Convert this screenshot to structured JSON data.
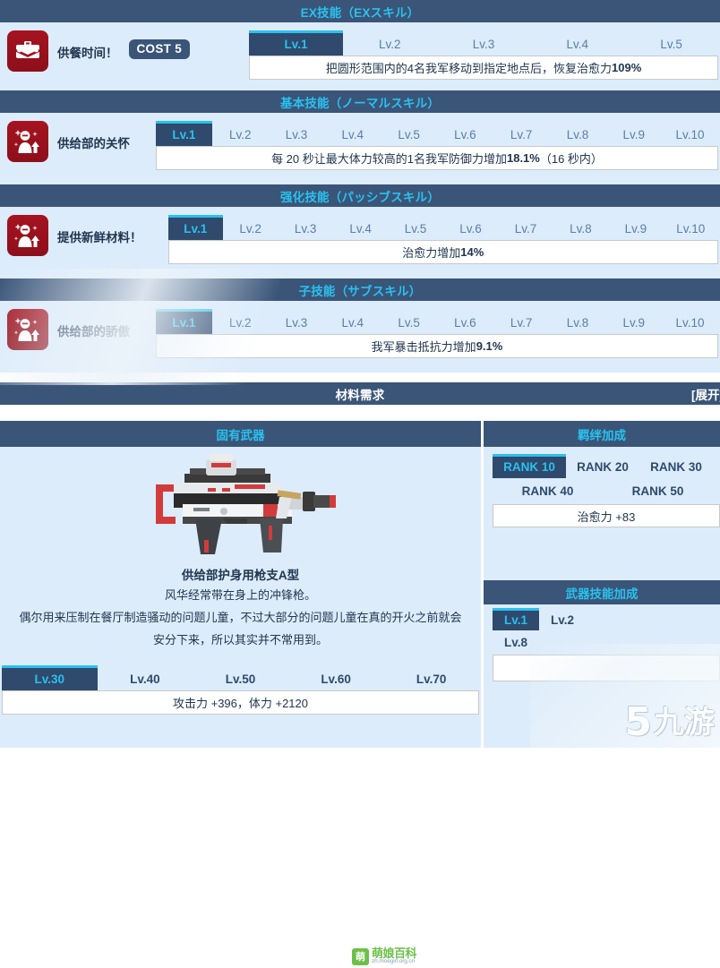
{
  "sections": [
    {
      "header_title": "EX技能（EXスキル）",
      "skill_name": "供餐时间！",
      "cost_label": "COST 5",
      "icon": "lunchbox-icon",
      "levels": [
        "Lv.1",
        "Lv.2",
        "Lv.3",
        "Lv.4",
        "Lv.5"
      ],
      "active_level": 0,
      "description": "把圆形范围内的4名我军移动到指定地点后，恢复治愈力 109%"
    },
    {
      "header_title": "基本技能（ノーマルスキル）",
      "skill_name": "供给部的关怀",
      "cost_label": "",
      "icon": "buff-character-icon",
      "levels": [
        "Lv.1",
        "Lv.2",
        "Lv.3",
        "Lv.4",
        "Lv.5",
        "Lv.6",
        "Lv.7",
        "Lv.8",
        "Lv.9",
        "Lv.10"
      ],
      "active_level": 0,
      "description": "每 20 秒让最大体力较高的1名我军防御力增加 18.1%（16 秒内）"
    },
    {
      "header_title": "强化技能（パッシブスキル）",
      "skill_name": "提供新鲜材料！",
      "cost_label": "",
      "icon": "buff-character-icon",
      "levels": [
        "Lv.1",
        "Lv.2",
        "Lv.3",
        "Lv.4",
        "Lv.5",
        "Lv.6",
        "Lv.7",
        "Lv.8",
        "Lv.9",
        "Lv.10"
      ],
      "active_level": 0,
      "description": "治愈力增加 14%"
    },
    {
      "header_title": "子技能（サブスキル）",
      "skill_name": "供给部的骄傲",
      "cost_label": "",
      "icon": "buff-character-icon",
      "levels": [
        "Lv.1",
        "Lv.2",
        "Lv.3",
        "Lv.4",
        "Lv.5",
        "Lv.6",
        "Lv.7",
        "Lv.8",
        "Lv.9",
        "Lv.10"
      ],
      "active_level": 0,
      "description": "我军暴击抵抗力增加 9.1%"
    }
  ],
  "material": {
    "header_title": "材料需求",
    "expand_label": "[展开]"
  },
  "weapon": {
    "header_title": "固有武器",
    "image_alt": "submachine-gun-image",
    "name": "供给部护身用枪支A型",
    "desc_line1": "风华经常带在身上的冲锋枪。",
    "desc_line2": "偶尔用来压制在餐厅制造骚动的问题儿童，不过大部分的问题儿童在真的开火之前就会",
    "desc_line3": "安分下来，所以其实并不常用到。",
    "levels": [
      "Lv.30",
      "Lv.40",
      "Lv.50",
      "Lv.60",
      "Lv.70"
    ],
    "active_level": 0,
    "stats": "攻击力 +396，体力 +2120"
  },
  "bond": {
    "header_title": "羁绊加成",
    "ranks_row1": [
      "RANK 10",
      "RANK 20",
      "RANK 30"
    ],
    "ranks_row2": [
      "RANK 40",
      "RANK 50"
    ],
    "active_rank": 0,
    "effect": "治愈力 +83"
  },
  "weapon_skill": {
    "header_title": "武器技能加成",
    "levels_row1": [
      "Lv.1",
      "Lv.2"
    ],
    "levels_row2": [
      "Lv.8"
    ],
    "active_level": 0
  },
  "watermarks": {
    "moegirl_badge": "萌",
    "moegirl_name": "萌娘百科",
    "moegirl_url": "zh.moegirl.org.cn",
    "jiuyou_mark": "5",
    "jiuyou_name": "九游"
  },
  "colors": {
    "header_bar": "#3a5578",
    "accent_cyan": "#29c1ef",
    "panel_bg": "#dcecfb",
    "tab_active_bg": "#2f4a6d",
    "icon_red": "#a61320",
    "text_navy": "#21364f"
  }
}
